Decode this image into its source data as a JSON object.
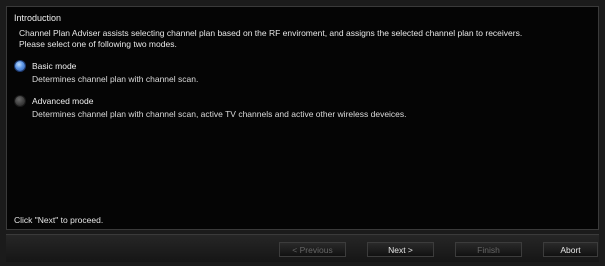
{
  "section": {
    "title": "Introduction",
    "intro_line1": "Channel Plan Adviser assists selecting channel plan based on the RF enviroment, and assigns the selected channel plan to receivers.",
    "intro_line2": "Please select one of following two modes."
  },
  "modes": {
    "basic": {
      "label": "Basic mode",
      "description": "Determines channel plan with channel scan.",
      "selected": true
    },
    "advanced": {
      "label": "Advanced mode",
      "description": "Determines channel plan with channel scan, active TV channels and active other wireless deveices.",
      "selected": false
    }
  },
  "proceed_text": "Click \"Next\" to proceed.",
  "buttons": {
    "previous": "< Previous",
    "next": "Next >",
    "finish": "Finish",
    "abort": "Abort"
  },
  "colors": {
    "radio_selected": "#5c95e6",
    "background": "#050505",
    "disabled_text": "#666666"
  }
}
